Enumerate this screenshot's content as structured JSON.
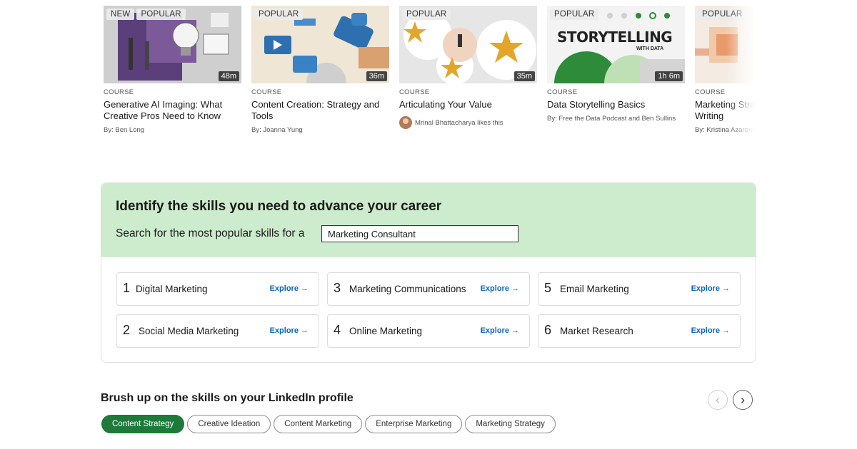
{
  "courses": [
    {
      "badges": [
        "NEW",
        "POPULAR"
      ],
      "duration": "48m",
      "type": "COURSE",
      "title": "Generative AI Imaging: What Creative Pros Need to Know",
      "byline": "By: Ben Long"
    },
    {
      "badges": [
        "POPULAR"
      ],
      "duration": "36m",
      "type": "COURSE",
      "title": "Content Creation: Strategy and Tools",
      "byline": "By: Joanna Yung"
    },
    {
      "badges": [
        "POPULAR"
      ],
      "duration": "35m",
      "type": "COURSE",
      "title": "Articulating Your Value",
      "likes": "Mrinal Bhattacharya likes this"
    },
    {
      "badges": [
        "POPULAR"
      ],
      "duration": "1h 6m",
      "type": "COURSE",
      "title": "Data Storytelling Basics",
      "byline": "By: Free the Data Podcast and Ben Sullins",
      "thumb_heading": "STORYTELLING",
      "thumb_sub": "WITH DATA"
    },
    {
      "badges": [
        "POPULAR"
      ],
      "type": "COURSE",
      "title": "Marketing Strategy: Content Writing",
      "byline": "By: Kristina Azarenko"
    }
  ],
  "skills_section": {
    "title": "Identify the skills you need to advance your career",
    "search_prompt": "Search for the most popular skills for a",
    "search_value": "Marketing Consultant",
    "explore_label": "Explore →",
    "skills": [
      {
        "rank": "1",
        "name": "Digital Marketing"
      },
      {
        "rank": "2",
        "name": "Social Media Marketing"
      },
      {
        "rank": "3",
        "name": "Marketing Communications"
      },
      {
        "rank": "4",
        "name": "Online Marketing"
      },
      {
        "rank": "5",
        "name": "Email Marketing"
      },
      {
        "rank": "6",
        "name": "Market Research"
      }
    ]
  },
  "profile_section": {
    "title": "Brush up on the skills on your LinkedIn profile",
    "prev_icon": "‹",
    "next_icon": "›",
    "pills": [
      "Content Strategy",
      "Creative Ideation",
      "Content Marketing",
      "Enterprise Marketing",
      "Marketing Strategy"
    ],
    "active_pill": "Content Strategy"
  },
  "colors": {
    "accent_green": "#1d7a3b",
    "banner_green": "#cdeccd",
    "link_blue": "#0a66c2"
  }
}
